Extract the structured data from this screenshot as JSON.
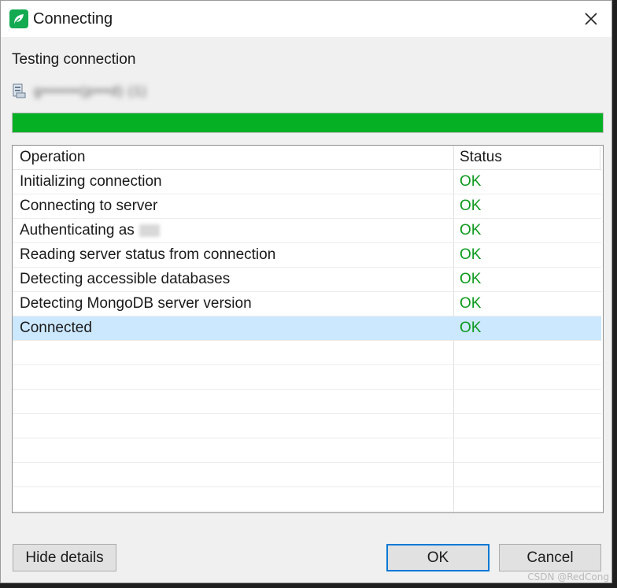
{
  "window": {
    "title": "Connecting",
    "icon": "mongodb-leaf-icon",
    "close_icon": "close-icon"
  },
  "testing_label": "Testing connection",
  "connection": {
    "icon": "server-icon",
    "name": "g•••••••(p•••d) (1)"
  },
  "progress": {
    "fraction": 1.0,
    "color": "#06b025"
  },
  "table": {
    "headers": {
      "operation": "Operation",
      "status": "Status"
    },
    "rows": [
      {
        "operation": "Initializing connection",
        "status": "OK"
      },
      {
        "operation": "Connecting to server",
        "status": "OK"
      },
      {
        "operation": "Authenticating as",
        "status": "OK"
      },
      {
        "operation": "Reading server status from connection",
        "status": "OK"
      },
      {
        "operation": "Detecting accessible databases",
        "status": "OK"
      },
      {
        "operation": "Detecting MongoDB server version",
        "status": "OK"
      },
      {
        "operation": "Connected",
        "status": "OK"
      }
    ],
    "selected_row": 6,
    "ok_color": "#0e9a1f",
    "selection_color": "#cce8ff"
  },
  "buttons": {
    "hide_details": "Hide details",
    "ok": "OK",
    "cancel": "Cancel"
  },
  "watermark": "CSDN @RedCong"
}
